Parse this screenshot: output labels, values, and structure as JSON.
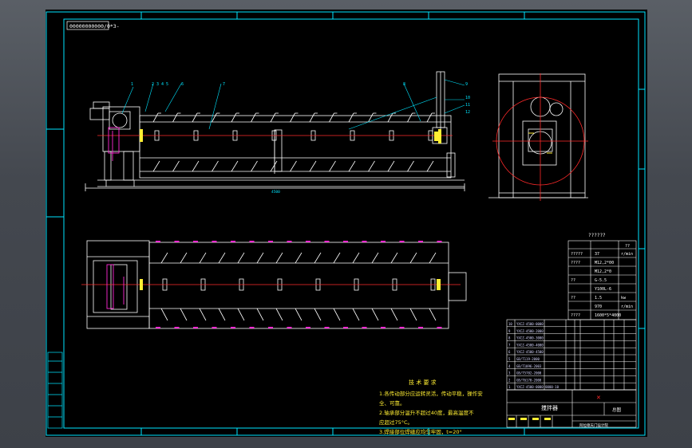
{
  "drawing_code": "00000000000/0*3-",
  "spec_heading": "??????",
  "spec_table": {
    "col_right_header": "??",
    "rows": [
      {
        "left": "?????",
        "mid": "37",
        "right": "r/min"
      },
      {
        "left": "????",
        "mid": "M12,2*00",
        "right": ""
      },
      {
        "left": "",
        "mid": "M12,2*0",
        "right": ""
      },
      {
        "left": "??",
        "mid": "G-5.5",
        "right": ""
      },
      {
        "left": "",
        "mid": "Y100L-6",
        "right": ""
      },
      {
        "left": "??",
        "mid": "1.5",
        "right": "kw"
      },
      {
        "left": "",
        "mid": "970",
        "right": "r/min"
      },
      {
        "left": "????",
        "mid": "1600*5*4000",
        "right": ""
      }
    ]
  },
  "bom_rows": [
    "YXCZ-4500-0000",
    "YXCZ-4500-2000",
    "YXCZ-4500-3000",
    "YXCZ-4500-4000",
    "YXCZ-4500-4500",
    "GB/T119-2000",
    "GB/T1096-2003",
    "GB/T5782-2000",
    "GB/T6170-2000",
    "YXCZ-4500-0000-0000-10"
  ],
  "title_block": {
    "name": "搅拌器",
    "material_cell": "总图",
    "footer": "阿拉德天门设计院"
  },
  "tech_requirements": {
    "heading": "技 术 要 求",
    "lines": [
      "1.各传动部分应运转灵活，传动平稳，操作安",
      "全、可靠。",
      "2.轴承部分温升不超过40度，最高温度不",
      "应超过75°C。",
      "3.焊接部位焊缝应均匀牢固，t=20°"
    ]
  },
  "palette": {
    "sheet": "#000000",
    "border": "#00e5ff",
    "geometry": "#ffffff",
    "center_line": "#ff2a2a",
    "highlight": "#ff2ad4",
    "leader": "#00e5ff",
    "table_text": "#d7d7ff",
    "yellow_text": "#ffee33"
  }
}
